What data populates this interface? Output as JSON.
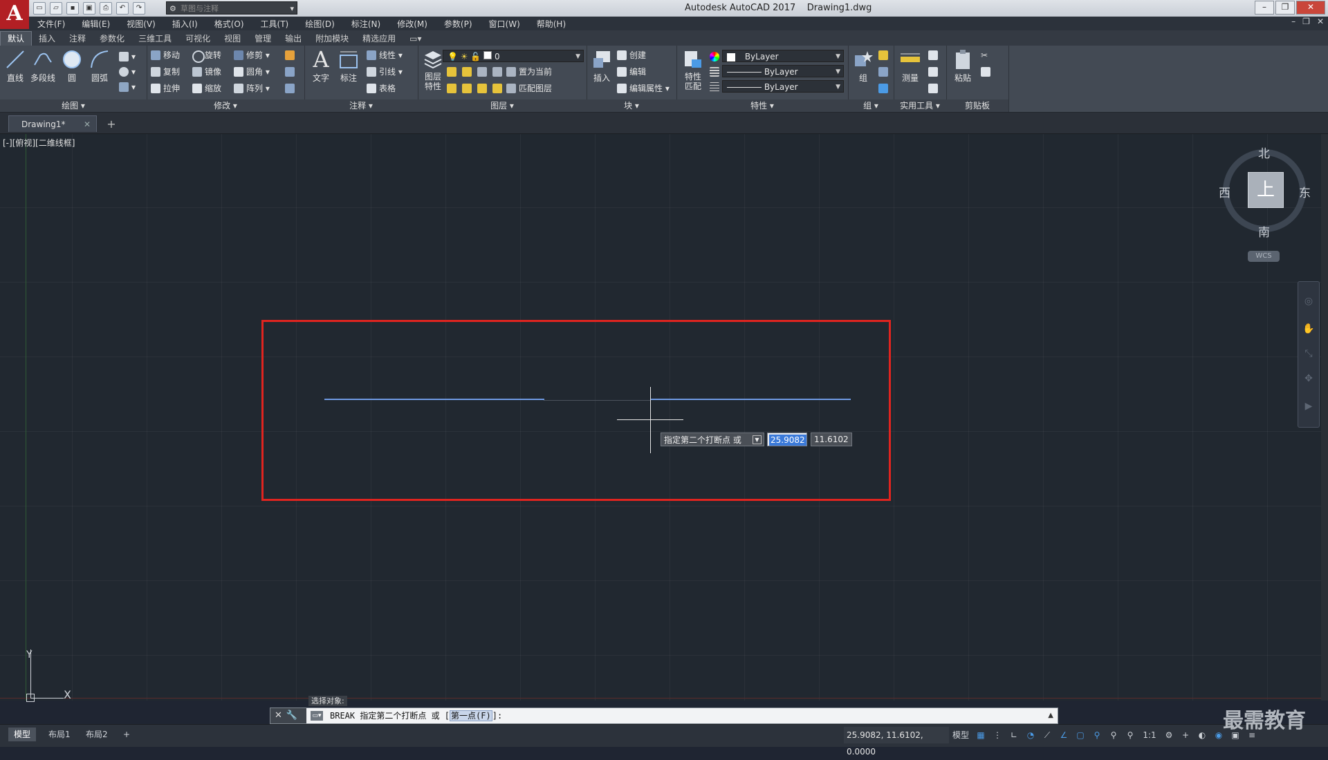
{
  "app": {
    "logo": "A",
    "title": "Autodesk AutoCAD 2017    Drawing1.dwg",
    "workspace": "草图与注释"
  },
  "menu": [
    "文件(F)",
    "编辑(E)",
    "视图(V)",
    "插入(I)",
    "格式(O)",
    "工具(T)",
    "绘图(D)",
    "标注(N)",
    "修改(M)",
    "参数(P)",
    "窗口(W)",
    "帮助(H)"
  ],
  "ribbon_tabs": [
    "默认",
    "插入",
    "注释",
    "参数化",
    "三维工具",
    "可视化",
    "视图",
    "管理",
    "输出",
    "附加模块",
    "精选应用"
  ],
  "ribbon": {
    "draw": {
      "title": "绘图",
      "line": "直线",
      "polyline": "多段线",
      "circle": "圆",
      "arc": "圆弧"
    },
    "modify": {
      "title": "修改",
      "move": "移动",
      "rotate": "旋转",
      "trim": "修剪",
      "copy": "复制",
      "mirror": "镜像",
      "fillet": "圆角",
      "stretch": "拉伸",
      "scale": "缩放",
      "array": "阵列"
    },
    "annotation": {
      "title": "注释",
      "text": "文字",
      "dimension": "标注",
      "linear": "线性",
      "leader": "引线",
      "table": "表格"
    },
    "layers": {
      "title": "图层",
      "layer_props": "图层\n特性",
      "current_layer": "0",
      "make_current": "置为当前",
      "match_layer": "匹配图层"
    },
    "block": {
      "title": "块",
      "insert": "插入",
      "create": "创建",
      "edit": "编辑",
      "edit_attr": "编辑属性"
    },
    "properties": {
      "title": "特性",
      "match": "特性\n匹配",
      "color": "ByLayer",
      "linetype": "ByLayer",
      "lineweight": "ByLayer"
    },
    "groups": {
      "title": "组",
      "group": "组"
    },
    "utilities": {
      "title": "实用工具",
      "measure": "测量"
    },
    "clipboard": {
      "title": "剪贴板",
      "paste": "粘贴"
    }
  },
  "file_tab": {
    "name": "Drawing1*"
  },
  "viewport_label": "[-][俯视][二维线框]",
  "viewcube": {
    "face": "上",
    "north": "北",
    "south": "南",
    "east": "东",
    "west": "西",
    "wcs": "WCS"
  },
  "ucs": {
    "x": "X",
    "y": "Y"
  },
  "dynamic_input": {
    "prompt": "指定第二个打断点 或",
    "x_value": "25.9082",
    "y_value": "11.6102"
  },
  "command": {
    "history": "选择对象:",
    "prefix": "BREAK 指定第二个打断点 或 [",
    "option": "第一点(F)",
    "suffix": "]:"
  },
  "layout_tabs": [
    "模型",
    "布局1",
    "布局2"
  ],
  "status": {
    "coords": "25.9082, 11.6102, 0.0000",
    "model": "模型",
    "scale": "1:1"
  },
  "watermark": "最需教育",
  "colors": {
    "canvas": "#212830",
    "highlight": "#e0241f",
    "line": "#6f9be4"
  }
}
